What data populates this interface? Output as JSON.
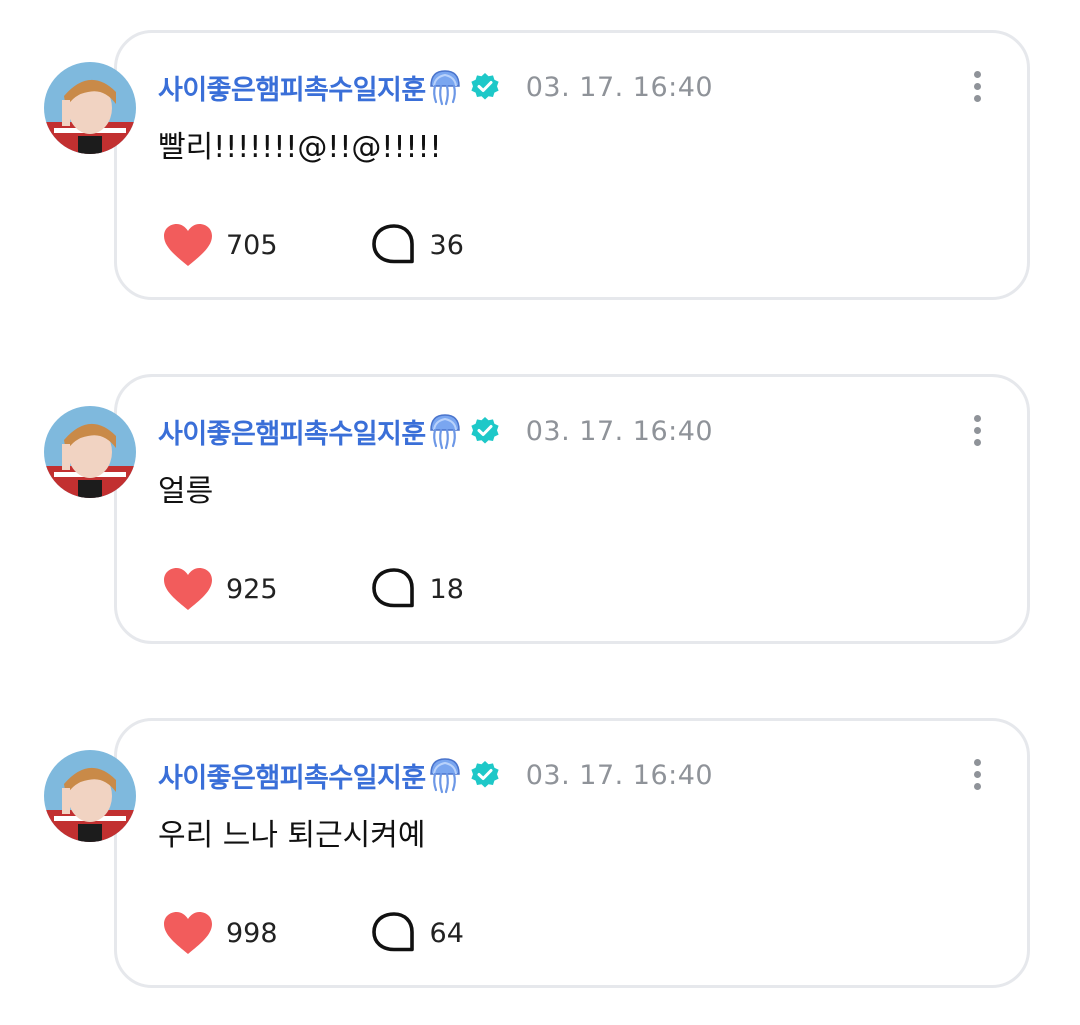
{
  "theme": {
    "username_color": "#3a6fd8",
    "heart_color": "#f25c5c",
    "verified_color": "#1ec8c8",
    "timestamp_color": "#8f9399"
  },
  "posts": [
    {
      "username": "사이좋은햄피촉수일지훈",
      "username_emoji": "jellyfish-icon",
      "verified": true,
      "timestamp": "03. 17. 16:40",
      "message": "빨리!!!!!!!@!!@!!!!!",
      "likes": "705",
      "comments": "36"
    },
    {
      "username": "사이좋은햄피촉수일지훈",
      "username_emoji": "jellyfish-icon",
      "verified": true,
      "timestamp": "03. 17. 16:40",
      "message": "얼릉",
      "likes": "925",
      "comments": "18"
    },
    {
      "username": "사이좋은햄피촉수일지훈",
      "username_emoji": "jellyfish-icon",
      "verified": true,
      "timestamp": "03. 17. 16:40",
      "message": "우리 느나 퇴근시켜예",
      "likes": "998",
      "comments": "64"
    }
  ]
}
